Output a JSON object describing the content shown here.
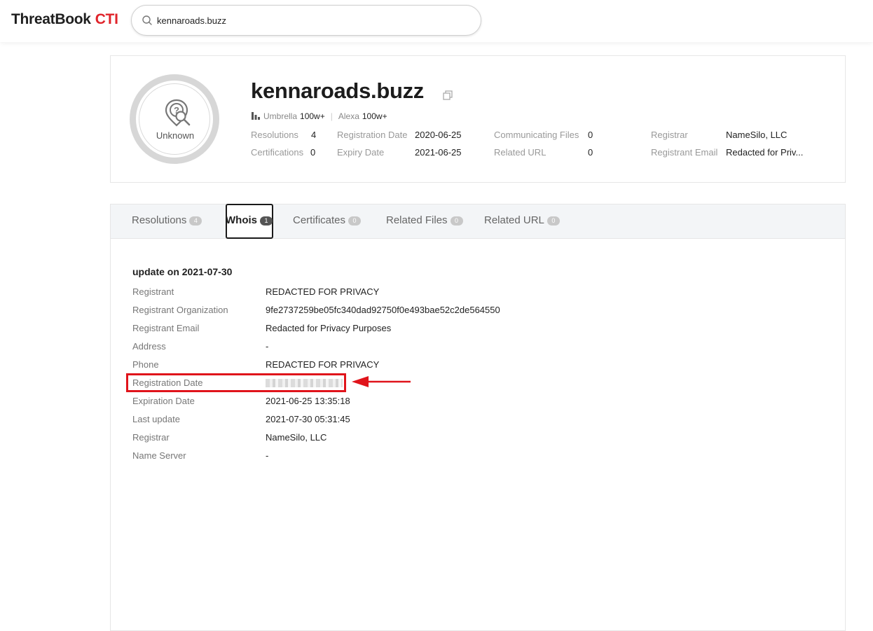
{
  "header": {
    "logo_text": "ThreatBook",
    "logo_accent": "CTI",
    "search_value": "kennaroads.buzz"
  },
  "summary": {
    "verdict": "Unknown",
    "domain": "kennaroads.buzz",
    "rank": {
      "umbrella_label": "Umbrella",
      "umbrella_value": "100w+",
      "alexa_label": "Alexa",
      "alexa_value": "100w+"
    },
    "meta": {
      "resolutions_label": "Resolutions",
      "resolutions_value": "4",
      "certifications_label": "Certifications",
      "certifications_value": "0",
      "registration_date_label": "Registration Date",
      "registration_date_value": "2020-06-25",
      "expiry_date_label": "Expiry Date",
      "expiry_date_value": "2021-06-25",
      "communicating_files_label": "Communicating Files",
      "communicating_files_value": "0",
      "related_url_label": "Related URL",
      "related_url_value": "0",
      "registrar_label": "Registrar",
      "registrar_value": "NameSilo, LLC",
      "registrant_email_label": "Registrant Email",
      "registrant_email_value": "Redacted for Priv..."
    }
  },
  "tabs": [
    {
      "label": "Resolutions",
      "count": "4"
    },
    {
      "label": "Whois",
      "count": "1"
    },
    {
      "label": "Certificates",
      "count": "0"
    },
    {
      "label": "Related Files",
      "count": "0"
    },
    {
      "label": "Related URL",
      "count": "0"
    }
  ],
  "whois": {
    "title": "update on 2021-07-30",
    "rows": [
      {
        "key": "Registrant",
        "value": "REDACTED FOR PRIVACY"
      },
      {
        "key": "Registrant Organization",
        "value": "9fe2737259be05fc340dad92750f0e493bae52c2de564550"
      },
      {
        "key": "Registrant Email",
        "value": "Redacted for Privacy Purposes"
      },
      {
        "key": "Address",
        "value": "-"
      },
      {
        "key": "Phone",
        "value": "REDACTED FOR PRIVACY"
      },
      {
        "key": "Registration Date",
        "value": ""
      },
      {
        "key": "Expiration Date",
        "value": "2021-06-25 13:35:18"
      },
      {
        "key": "Last update",
        "value": "2021-07-30 05:31:45"
      },
      {
        "key": "Registrar",
        "value": "NameSilo, LLC"
      },
      {
        "key": "Name Server",
        "value": "-"
      }
    ]
  },
  "colors": {
    "brand_red": "#e0242b",
    "highlight_red": "#e0141b"
  }
}
